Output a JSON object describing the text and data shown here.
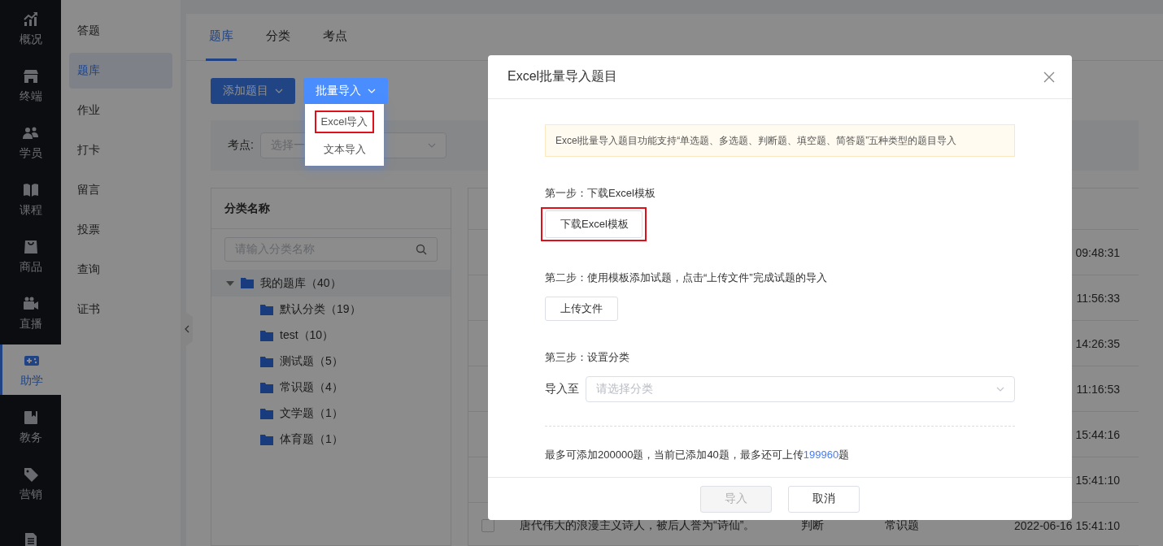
{
  "nav": {
    "items": [
      {
        "label": "概况",
        "selected": false
      },
      {
        "label": "终端",
        "selected": false
      },
      {
        "label": "学员",
        "selected": false
      },
      {
        "label": "课程",
        "selected": false
      },
      {
        "label": "商品",
        "selected": false
      },
      {
        "label": "直播",
        "selected": false
      },
      {
        "label": "助学",
        "selected": true
      },
      {
        "label": "教务",
        "selected": false
      },
      {
        "label": "营销",
        "selected": false
      }
    ]
  },
  "subnav": {
    "items": [
      {
        "label": "答题",
        "selected": false
      },
      {
        "label": "题库",
        "selected": true
      },
      {
        "label": "作业",
        "selected": false
      },
      {
        "label": "打卡",
        "selected": false
      },
      {
        "label": "留言",
        "selected": false
      },
      {
        "label": "投票",
        "selected": false
      },
      {
        "label": "查询",
        "selected": false
      },
      {
        "label": "证书",
        "selected": false
      }
    ]
  },
  "tabs": [
    {
      "label": "题库",
      "selected": true
    },
    {
      "label": "分类",
      "selected": false
    },
    {
      "label": "考点",
      "selected": false
    }
  ],
  "toolbar": {
    "add_button": {
      "label": "添加题目"
    },
    "import_button": {
      "label": "批量导入",
      "open": true,
      "menu": [
        {
          "label": "Excel导入",
          "highlighted": true
        },
        {
          "label": "文本导入",
          "highlighted": false
        }
      ]
    }
  },
  "filter": {
    "label": "考点:",
    "placeholder": "选择一"
  },
  "category_panel": {
    "header": "分类名称",
    "search_placeholder": "请输入分类名称",
    "tree": [
      {
        "label": "我的题库（40）",
        "selected": true,
        "expanded": true,
        "children": [
          {
            "label": "默认分类（19）",
            "selected": false
          },
          {
            "label": "test（10）",
            "selected": false
          },
          {
            "label": "测试题（5）",
            "selected": false
          },
          {
            "label": "常识题（4）",
            "selected": false
          },
          {
            "label": "文学题（1）",
            "selected": false
          },
          {
            "label": "体育题（1）",
            "selected": false
          }
        ]
      }
    ]
  },
  "question_table": {
    "rows": [
      {
        "date": "09:48:31"
      },
      {
        "date": "11:56:33"
      },
      {
        "date": "14:26:35"
      },
      {
        "date": "11:16:53"
      },
      {
        "date": "15:44:16"
      },
      {
        "date": "15:41:10"
      },
      {
        "checked": false,
        "question": "唐代伟大的浪漫主义诗人，被后人誉为“诗仙”。",
        "type": "判断",
        "category": "常识题",
        "date": "2022-06-16 15:41:10"
      }
    ]
  },
  "modal": {
    "title": "Excel批量导入题目",
    "notice": "Excel批量导入题目功能支持“单选题、多选题、判断题、填空题、简答题”五种类型的题目导入",
    "steps": [
      {
        "kind": "button",
        "label": "第一步：下载Excel模板",
        "button": {
          "label": "下载Excel模板",
          "highlighted": true
        }
      },
      {
        "kind": "button",
        "label": "第二步：使用模板添加试题，点击“上传文件”完成试题的导入",
        "button": {
          "label": "上传文件",
          "highlighted": false
        }
      },
      {
        "kind": "select",
        "label": "第三步：设置分类",
        "field_label": "导入至",
        "placeholder": "请选择分类"
      }
    ],
    "quota": {
      "before": "最多可添加200000题，当前已添加40题，最多还可上传",
      "number": "199960",
      "after": "题"
    },
    "footer_buttons": [
      {
        "label": "导入",
        "disabled": true
      },
      {
        "label": "取消",
        "disabled": false
      }
    ]
  }
}
